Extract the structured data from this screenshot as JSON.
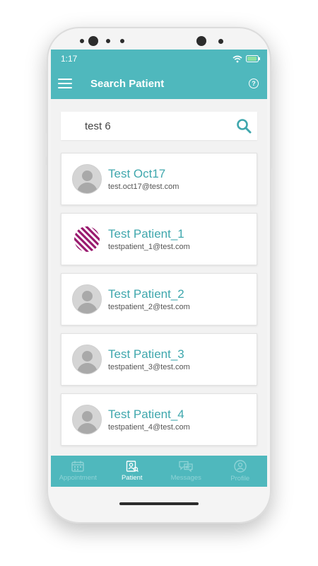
{
  "status": {
    "time": "1:17"
  },
  "appbar": {
    "title": "Search Patient"
  },
  "search": {
    "value": "test 6"
  },
  "patients": [
    {
      "name": "Test Oct17",
      "email": "test.oct17@test.com",
      "avatar": "placeholder"
    },
    {
      "name": "Test Patient_1",
      "email": "testpatient_1@test.com",
      "avatar": "logo"
    },
    {
      "name": "Test Patient_2",
      "email": "testpatient_2@test.com",
      "avatar": "placeholder"
    },
    {
      "name": "Test Patient_3",
      "email": "testpatient_3@test.com",
      "avatar": "placeholder"
    },
    {
      "name": "Test Patient_4",
      "email": "testpatient_4@test.com",
      "avatar": "placeholder"
    }
  ],
  "tabs": [
    {
      "label": "Appointment",
      "icon": "calendar-icon",
      "active": false
    },
    {
      "label": "Patient",
      "icon": "patient-icon",
      "active": true
    },
    {
      "label": "Messages",
      "icon": "messages-icon",
      "active": false
    },
    {
      "label": "Profile",
      "icon": "profile-icon",
      "active": false
    }
  ],
  "colors": {
    "brand": "#4fb8bd",
    "name_text": "#3fa7ad",
    "search_icon": "#3fa7ad"
  }
}
